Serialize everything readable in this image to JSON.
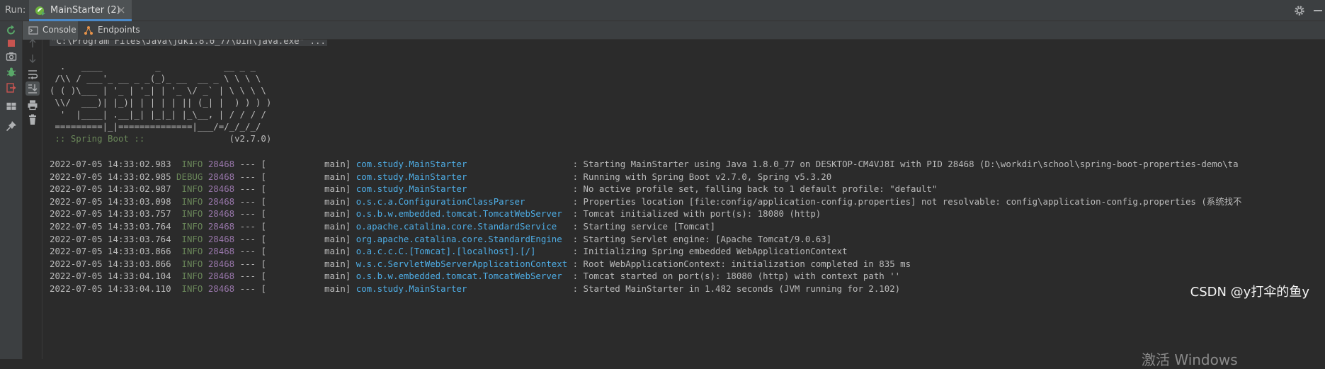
{
  "header": {
    "run_label": "Run:",
    "run_tab_label": "MainStarter (2)",
    "close_glyph": "×"
  },
  "subtabs": [
    {
      "label": "Console",
      "icon": "console-icon",
      "active": true
    },
    {
      "label": "Endpoints",
      "icon": "endpoints-icon",
      "active": false
    }
  ],
  "left_toolbar_icons": [
    "rerun-icon",
    "stop-icon",
    "camera-icon",
    "debug-bug-icon",
    "exit-icon",
    "layout-icon",
    "pin-icon"
  ],
  "second_toolbar_icons": [
    "arrow-up-icon",
    "arrow-down-icon",
    "soft-wrap-icon",
    "scroll-to-end-icon",
    "print-icon",
    "trash-icon"
  ],
  "console": {
    "command_line": "\"C:\\Program Files\\Java\\jdk1.8.0_77\\bin\\java.exe\" ...",
    "banner": [
      "  .   ____          _            __ _ _",
      " /\\\\ / ___'_ __ _ _(_)_ __  __ _ \\ \\ \\ \\",
      "( ( )\\___ | '_ | '_| | '_ \\/ _` | \\ \\ \\ \\",
      " \\\\/  ___)| |_)| | | | | || (_| |  ) ) ) )",
      "  '  |____| .__|_| |_|_| |_\\__, | / / / /",
      " =========|_|==============|___/=/_/_/_/"
    ],
    "boot_label": " :: Spring Boot ::",
    "boot_version": "(v2.7.0)",
    "log_lines": [
      {
        "ts": "2022-07-05 14:33:02.983",
        "level": " INFO",
        "pid": "28468",
        "sep": "--- [",
        "thread": "main]",
        "logger": "com.study.MainStarter",
        "msg": ": Starting MainStarter using Java 1.8.0_77 on DESKTOP-CM4VJ8I with PID 28468 (D:\\workdir\\school\\spring-boot-properties-demo\\ta"
      },
      {
        "ts": "2022-07-05 14:33:02.985",
        "level": "DEBUG",
        "pid": "28468",
        "sep": "--- [",
        "thread": "main]",
        "logger": "com.study.MainStarter",
        "msg": ": Running with Spring Boot v2.7.0, Spring v5.3.20"
      },
      {
        "ts": "2022-07-05 14:33:02.987",
        "level": " INFO",
        "pid": "28468",
        "sep": "--- [",
        "thread": "main]",
        "logger": "com.study.MainStarter",
        "msg": ": No active profile set, falling back to 1 default profile: \"default\""
      },
      {
        "ts": "2022-07-05 14:33:03.098",
        "level": " INFO",
        "pid": "28468",
        "sep": "--- [",
        "thread": "main]",
        "logger": "o.s.c.a.ConfigurationClassParser",
        "msg": ": Properties location [file:config/application-config.properties] not resolvable: config\\application-config.properties (系统找不"
      },
      {
        "ts": "2022-07-05 14:33:03.757",
        "level": " INFO",
        "pid": "28468",
        "sep": "--- [",
        "thread": "main]",
        "logger": "o.s.b.w.embedded.tomcat.TomcatWebServer",
        "msg": ": Tomcat initialized with port(s): 18080 (http)"
      },
      {
        "ts": "2022-07-05 14:33:03.764",
        "level": " INFO",
        "pid": "28468",
        "sep": "--- [",
        "thread": "main]",
        "logger": "o.apache.catalina.core.StandardService",
        "msg": ": Starting service [Tomcat]"
      },
      {
        "ts": "2022-07-05 14:33:03.764",
        "level": " INFO",
        "pid": "28468",
        "sep": "--- [",
        "thread": "main]",
        "logger": "org.apache.catalina.core.StandardEngine",
        "msg": ": Starting Servlet engine: [Apache Tomcat/9.0.63]"
      },
      {
        "ts": "2022-07-05 14:33:03.866",
        "level": " INFO",
        "pid": "28468",
        "sep": "--- [",
        "thread": "main]",
        "logger": "o.a.c.c.C.[Tomcat].[localhost].[/]",
        "msg": ": Initializing Spring embedded WebApplicationContext"
      },
      {
        "ts": "2022-07-05 14:33:03.866",
        "level": " INFO",
        "pid": "28468",
        "sep": "--- [",
        "thread": "main]",
        "logger": "w.s.c.ServletWebServerApplicationContext",
        "msg": ": Root WebApplicationContext: initialization completed in 835 ms"
      },
      {
        "ts": "2022-07-05 14:33:04.104",
        "level": " INFO",
        "pid": "28468",
        "sep": "--- [",
        "thread": "main]",
        "logger": "o.s.b.w.embedded.tomcat.TomcatWebServer",
        "msg": ": Tomcat started on port(s): 18080 (http) with context path ''"
      },
      {
        "ts": "2022-07-05 14:33:04.110",
        "level": " INFO",
        "pid": "28468",
        "sep": "--- [",
        "thread": "main]",
        "logger": "com.study.MainStarter",
        "msg": ": Started MainStarter in 1.482 seconds (JVM running for 2.102)"
      }
    ]
  },
  "watermark": "CSDN @y打伞的鱼y",
  "activate_text": "激活 Windows"
}
